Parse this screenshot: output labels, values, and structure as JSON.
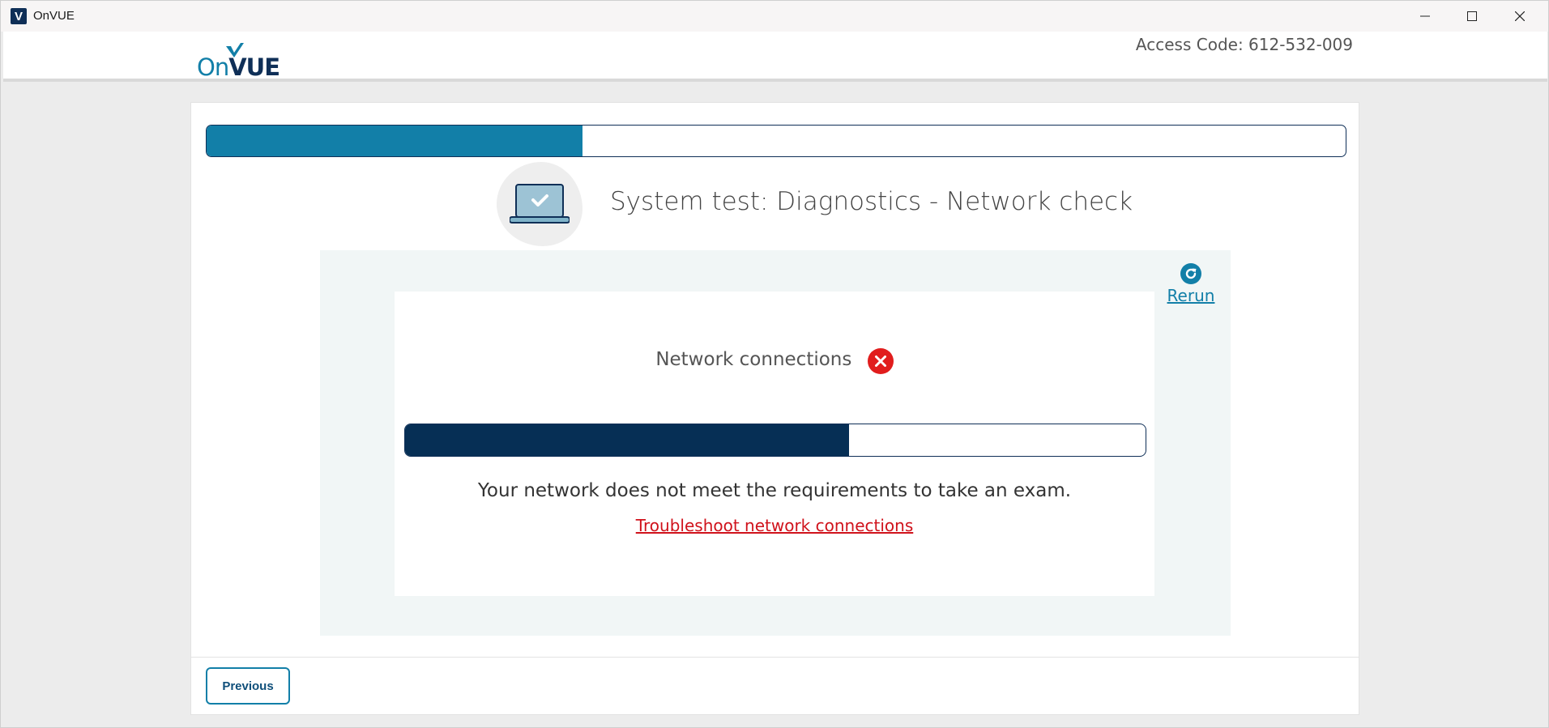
{
  "window": {
    "title": "OnVUE",
    "icon_letter": "V"
  },
  "header": {
    "logo_on": "On",
    "logo_vue": "VUE",
    "access_code": "Access Code: 612-532-009"
  },
  "progress": {
    "overall_fraction": 0.33
  },
  "step": {
    "title": "System test: Diagnostics - Network check"
  },
  "panel": {
    "rerun_label": "Rerun",
    "network_label": "Network connections",
    "network_progress_fraction": 0.6,
    "message": "Your network does not meet the requirements to take an exam.",
    "troubleshoot_link": "Troubleshoot network connections"
  },
  "footer": {
    "previous_label": "Previous"
  },
  "colors": {
    "accent": "#127fa8",
    "navy": "#0f2f57",
    "error": "#e11d1d"
  }
}
